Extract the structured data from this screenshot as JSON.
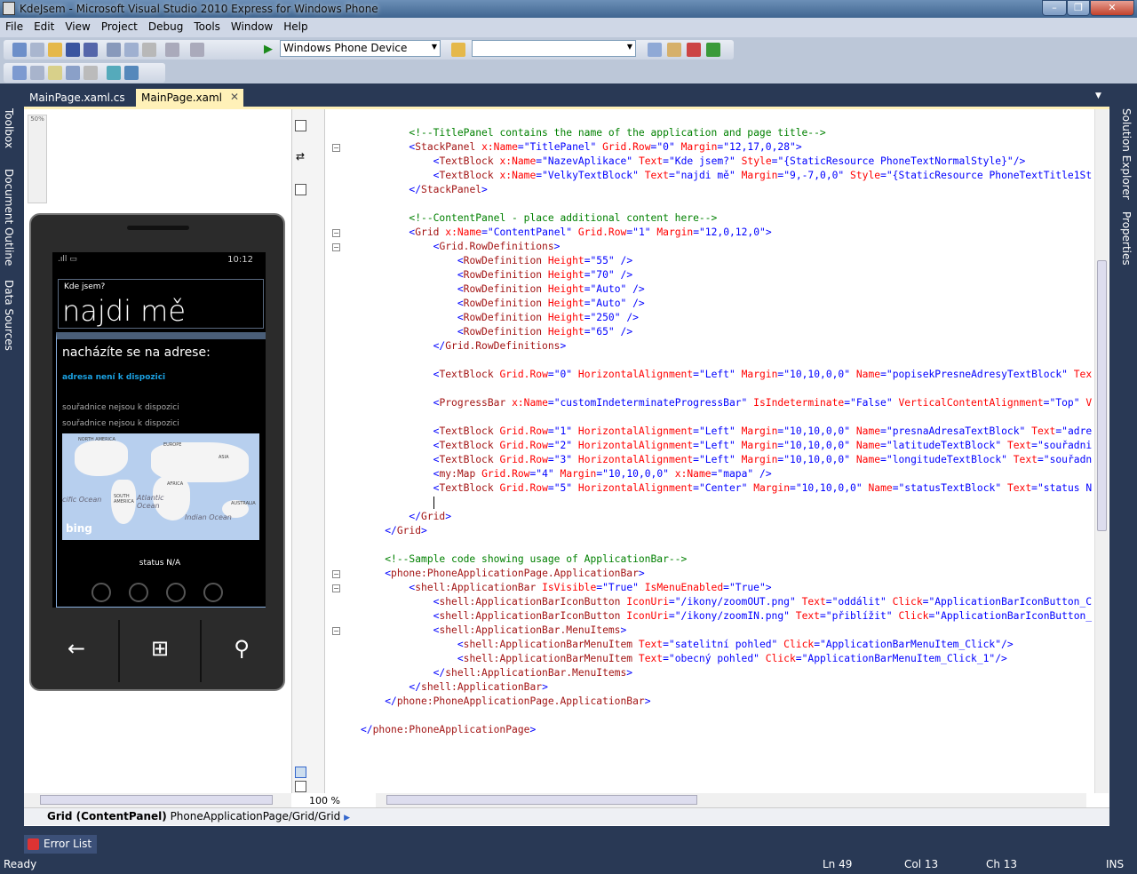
{
  "window": {
    "title": "KdeJsem - Microsoft Visual Studio 2010 Express for Windows Phone",
    "controls": [
      "–",
      "❐",
      "✕"
    ]
  },
  "menu": [
    "File",
    "Edit",
    "View",
    "Project",
    "Debug",
    "Tools",
    "Window",
    "Help"
  ],
  "toolbar": {
    "target_device": "Windows Phone Device",
    "config_combo": ""
  },
  "tabs": [
    {
      "label": "MainPage.xaml.cs",
      "active": false
    },
    {
      "label": "MainPage.xaml",
      "active": true
    }
  ],
  "left_panels": [
    "Toolbox",
    "Document Outline",
    "Data Sources"
  ],
  "right_panels": [
    "Solution Explorer",
    "Properties"
  ],
  "designer": {
    "zoom_slider": "50%",
    "phone": {
      "time": "10:12",
      "app_name": "Kde jsem?",
      "page_title": "najdi mě",
      "label_address": "nacházíte se na adrese:",
      "address": "adresa není k dispozici",
      "latitude": "souřadnice nejsou k dispozici",
      "longitude": "souřadnice nejsou k dispozici",
      "status": "status N/A",
      "row_heights": [
        "55",
        "70",
        "Auto",
        "Auto",
        "250",
        "65"
      ],
      "map": {
        "labels": [
          "NORTH AMERICA",
          "EUROPE",
          "ASIA",
          "AFRICA",
          "SOUTH AMERICA",
          "Atlantic Ocean",
          "cific Ocean",
          "Indian Ocean",
          "AUSTRALIA"
        ],
        "logo": "bing"
      },
      "accent": "#1ba1e2"
    }
  },
  "code_lines": [
    "        <!--TitlePanel contains the name of the application and page title-->",
    "        <StackPanel x:Name=\"TitlePanel\" Grid.Row=\"0\" Margin=\"12,17,0,28\">",
    "            <TextBlock x:Name=\"NazevAplikace\" Text=\"Kde jsem?\" Style=\"{StaticResource PhoneTextNormalStyle}\"/>",
    "            <TextBlock x:Name=\"VelkyTextBlock\" Text=\"najdi mě\" Margin=\"9,-7,0,0\" Style=\"{StaticResource PhoneTextTitle1St",
    "        </StackPanel>",
    "",
    "        <!--ContentPanel - place additional content here-->",
    "        <Grid x:Name=\"ContentPanel\" Grid.Row=\"1\" Margin=\"12,0,12,0\">",
    "            <Grid.RowDefinitions>",
    "                <RowDefinition Height=\"55\" />",
    "                <RowDefinition Height=\"70\" />",
    "                <RowDefinition Height=\"Auto\" />",
    "                <RowDefinition Height=\"Auto\" />",
    "                <RowDefinition Height=\"250\" />",
    "                <RowDefinition Height=\"65\" />",
    "            </Grid.RowDefinitions>",
    "",
    "            <TextBlock Grid.Row=\"0\" HorizontalAlignment=\"Left\" Margin=\"10,10,0,0\" Name=\"popisekPresneAdresyTextBlock\" Tex",
    "",
    "            <ProgressBar x:Name=\"customIndeterminateProgressBar\" IsIndeterminate=\"False\" VerticalContentAlignment=\"Top\" V",
    "",
    "            <TextBlock Grid.Row=\"1\" HorizontalAlignment=\"Left\" Margin=\"10,10,0,0\" Name=\"presnaAdresaTextBlock\" Text=\"adre",
    "            <TextBlock Grid.Row=\"2\" HorizontalAlignment=\"Left\" Margin=\"10,10,0,0\" Name=\"latitudeTextBlock\" Text=\"souřadni",
    "            <TextBlock Grid.Row=\"3\" HorizontalAlignment=\"Left\" Margin=\"10,10,0,0\" Name=\"longitudeTextBlock\" Text=\"souřadn",
    "            <my:Map Grid.Row=\"4\" Margin=\"10,10,0,0\" x:Name=\"mapa\" />",
    "            <TextBlock Grid.Row=\"5\" HorizontalAlignment=\"Center\" Margin=\"10,10,0,0\" Name=\"statusTextBlock\" Text=\"status N",
    "            ",
    "        </Grid>",
    "    </Grid>",
    "",
    "    <!--Sample code showing usage of ApplicationBar-->",
    "    <phone:PhoneApplicationPage.ApplicationBar>",
    "        <shell:ApplicationBar IsVisible=\"True\" IsMenuEnabled=\"True\">",
    "            <shell:ApplicationBarIconButton IconUri=\"/ikony/zoomOUT.png\" Text=\"oddálit\" Click=\"ApplicationBarIconButton_C",
    "            <shell:ApplicationBarIconButton IconUri=\"/ikony/zoomIN.png\" Text=\"přiblížit\" Click=\"ApplicationBarIconButton_",
    "            <shell:ApplicationBar.MenuItems>",
    "                <shell:ApplicationBarMenuItem Text=\"satelitní pohled\" Click=\"ApplicationBarMenuItem_Click\"/>",
    "                <shell:ApplicationBarMenuItem Text=\"obecný pohled\" Click=\"ApplicationBarMenuItem_Click_1\"/>",
    "            </shell:ApplicationBar.MenuItems>",
    "        </shell:ApplicationBar>",
    "    </phone:PhoneApplicationPage.ApplicationBar>",
    "",
    "</phone:PhoneApplicationPage>"
  ],
  "editor": {
    "zoom": "100 %"
  },
  "breadcrumb": {
    "element": "Grid (ContentPanel)",
    "path": "PhoneApplicationPage/Grid/Grid"
  },
  "bottom_tabs": [
    "Error List"
  ],
  "status": {
    "text": "Ready",
    "line": "Ln 49",
    "col": "Col 13",
    "ch": "Ch 13",
    "mode": "INS"
  }
}
